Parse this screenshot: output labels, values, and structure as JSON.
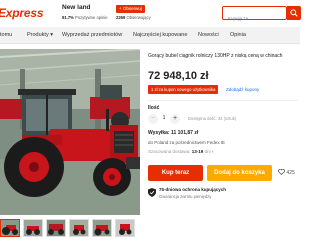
{
  "header": {
    "logo_text": "Express",
    "store_name": "New land",
    "positive_pct": "91.7%",
    "positive_label": "Pozytywne opinie",
    "follow_label": "+ Obserwuj",
    "followers_count": "2269",
    "followers_label": "Obserwujący",
    "search_placeholder": "Kupuję za..."
  },
  "nav": {
    "items": [
      "tomu",
      "Produkty ▾",
      "Wyprzedaż przedmiotów",
      "Najczęściej kupowane",
      "Nowości",
      "Opinia"
    ]
  },
  "product": {
    "title": "Gorący bubel ciągnik rolniczy 130HP z niską ceną w chinach",
    "price": "72 948,10 zł",
    "coupon_badge": "1 zł za kupon nowego użytkownika",
    "coupon_link": "Zdobądź kupony",
    "quantity_label": "Ilość",
    "quantity_value": "1",
    "quantity_minus": "−",
    "quantity_plus": "+",
    "availability": "Dostępna ilość: 34 (sztuk)",
    "shipping_label": "Wysyłka: 11 101,87 zł",
    "shipping_to": "do Poland za pośrednictwem Fedex IE",
    "delivery_label": "Szacowana dostawa:",
    "delivery_days": "13-19",
    "delivery_days_unit": "dni",
    "delivery_chevron": "›",
    "buy_now": "Kup teraz",
    "add_to_cart": "Dodaj do koszyka",
    "wishlist_count": "425",
    "wishlist_icon": "heart-icon",
    "protection_title": "75-dniowa ochrona kupujących",
    "protection_sub": "Gwarancja zwrotu pieniędzy"
  },
  "gallery": {
    "thumbnail_count": 6,
    "selected_index": 0
  },
  "colors": {
    "brand_red": "#e62e04",
    "cart_orange": "#fea800",
    "tractor_red": "#c8141b",
    "link_blue": "#1f6fd6"
  }
}
